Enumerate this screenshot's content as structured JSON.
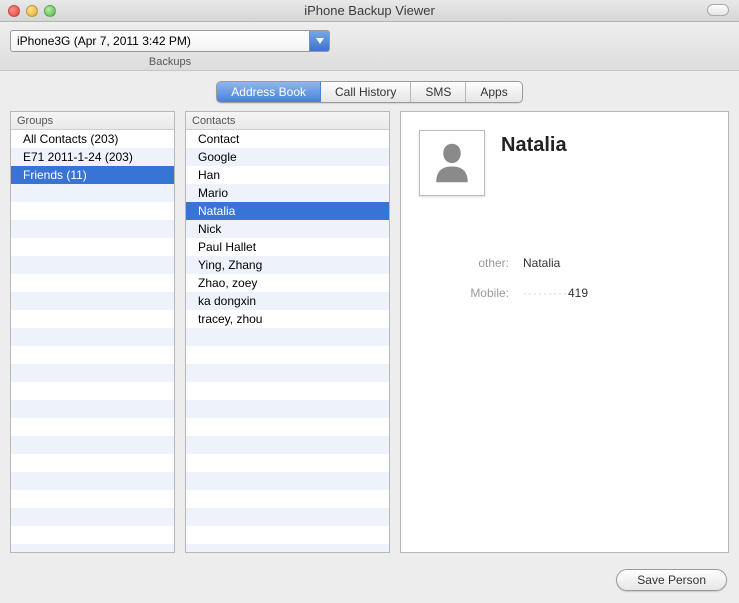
{
  "window_title": "iPhone Backup Viewer",
  "backup_selector": {
    "value": "iPhone3G (Apr 7, 2011 3:42 PM)",
    "label": "Backups"
  },
  "tabs": [
    {
      "label": "Address Book",
      "active": true
    },
    {
      "label": "Call History",
      "active": false
    },
    {
      "label": "SMS",
      "active": false
    },
    {
      "label": "Apps",
      "active": false
    }
  ],
  "groups": {
    "header": "Groups",
    "items": [
      {
        "label": "All Contacts (203)",
        "selected": false
      },
      {
        "label": "E71 2011-1-24 (203)",
        "selected": false
      },
      {
        "label": "Friends (11)",
        "selected": true
      }
    ]
  },
  "contacts": {
    "header": "Contacts",
    "items": [
      {
        "label": "Contact",
        "selected": false
      },
      {
        "label": "Google",
        "selected": false
      },
      {
        "label": "Han",
        "selected": false
      },
      {
        "label": "Mario",
        "selected": false
      },
      {
        "label": "Natalia",
        "selected": true
      },
      {
        "label": "Nick",
        "selected": false
      },
      {
        "label": "Paul Hallet",
        "selected": false
      },
      {
        "label": "Ying, Zhang",
        "selected": false
      },
      {
        "label": "Zhao, zoey",
        "selected": false
      },
      {
        "label": "ka dongxin",
        "selected": false
      },
      {
        "label": "tracey, zhou",
        "selected": false
      }
    ]
  },
  "detail": {
    "name": "Natalia",
    "fields": [
      {
        "label": "other:",
        "value": "Natalia",
        "obscured_prefix": ""
      },
      {
        "label": "Mobile:",
        "value": "419",
        "obscured_prefix": "·········"
      }
    ]
  },
  "footer": {
    "save_label": "Save Person"
  }
}
